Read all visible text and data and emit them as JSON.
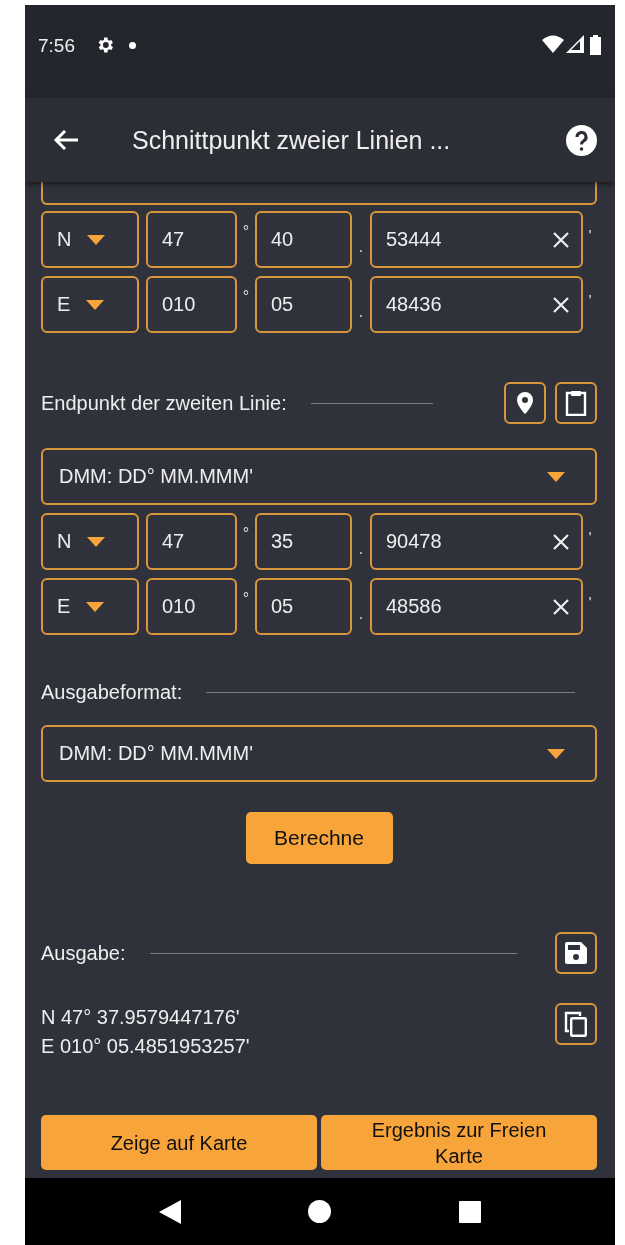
{
  "status_bar": {
    "time": "7:56"
  },
  "app_bar": {
    "title": "Schnittpunkt zweier Linien ..."
  },
  "first_point": {
    "rows": [
      {
        "hemisphere": "N",
        "degrees": "47",
        "degree_mark": "°",
        "minutes": "40",
        "decimal_point": ".",
        "decimals": "53444",
        "minute_mark": "'"
      },
      {
        "hemisphere": "E",
        "degrees": "010",
        "degree_mark": "°",
        "minutes": "05",
        "decimal_point": ".",
        "decimals": "48436",
        "minute_mark": "'"
      }
    ]
  },
  "second_point": {
    "label": "Endpunkt der zweiten Linie:",
    "format": "DMM: DD° MM.MMM'",
    "rows": [
      {
        "hemisphere": "N",
        "degrees": "47",
        "degree_mark": "°",
        "minutes": "35",
        "decimal_point": ".",
        "decimals": "90478",
        "minute_mark": "'"
      },
      {
        "hemisphere": "E",
        "degrees": "010",
        "degree_mark": "°",
        "minutes": "05",
        "decimal_point": ".",
        "decimals": "48586",
        "minute_mark": "'"
      }
    ]
  },
  "output_format": {
    "label": "Ausgabeformat:",
    "format": "DMM: DD° MM.MMM'"
  },
  "calculate_button": "Berechne",
  "output": {
    "label": "Ausgabe:",
    "lines": [
      "N 47° 37.9579447176'",
      "E 010° 05.4851953257'"
    ]
  },
  "actions": [
    "Zeige auf Karte",
    "Ergebnis zur Freien Karte"
  ]
}
